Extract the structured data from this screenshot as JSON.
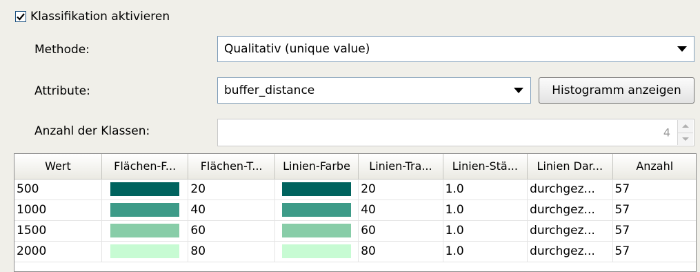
{
  "enable_classification": {
    "label": "Klassifikation aktivieren",
    "checked": true
  },
  "method": {
    "label": "Methode:",
    "value": "Qualitativ (unique value)"
  },
  "attribute": {
    "label": "Attribute:",
    "value": "buffer_distance",
    "histogram_button": "Histogramm anzeigen"
  },
  "classes": {
    "label": "Anzahl der Klassen:",
    "value": "4"
  },
  "table": {
    "headers": [
      "Wert",
      "Flächen-F...",
      "Flächen-T...",
      "Linien-Farbe",
      "Linien-Tra...",
      "Linien-Stä...",
      "Linien Dar...",
      "Anzahl"
    ],
    "rows": [
      {
        "wert": "500",
        "fill_color": "#00635e",
        "fill_transparency": "20",
        "line_color": "#00635e",
        "line_transparency": "20",
        "line_width": "1.0",
        "line_style": "durchgez...",
        "count": "57"
      },
      {
        "wert": "1000",
        "fill_color": "#3d9b88",
        "fill_transparency": "40",
        "line_color": "#3d9b88",
        "line_transparency": "40",
        "line_width": "1.0",
        "line_style": "durchgez...",
        "count": "57"
      },
      {
        "wert": "1500",
        "fill_color": "#88cda8",
        "fill_transparency": "60",
        "line_color": "#88cda8",
        "line_transparency": "60",
        "line_width": "1.0",
        "line_style": "durchgez...",
        "count": "57"
      },
      {
        "wert": "2000",
        "fill_color": "#c7fbd3",
        "fill_transparency": "80",
        "line_color": "#c7fbd3",
        "line_transparency": "80",
        "line_width": "1.0",
        "line_style": "durchgez...",
        "count": "57"
      }
    ]
  }
}
